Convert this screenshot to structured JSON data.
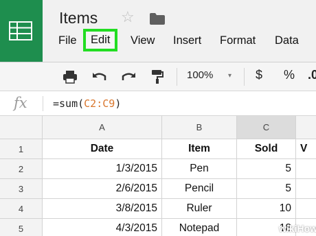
{
  "app": {
    "logo_icon": "sheets-grid-icon",
    "title": "Items",
    "star_icon": "star-icon",
    "folder_icon": "folder-icon"
  },
  "menu": {
    "items": [
      "File",
      "Edit",
      "View",
      "Insert",
      "Format",
      "Data"
    ],
    "highlighted": "Edit"
  },
  "toolbar": {
    "print_icon": "print-icon",
    "undo_icon": "undo-icon",
    "redo_icon": "redo-icon",
    "paint_format_icon": "paint-format-icon",
    "zoom": "100%",
    "zoom_caret": "▾",
    "currency": "$",
    "percent": "%",
    "decrease_decimal": ".0"
  },
  "formula_bar": {
    "fx_label": "fx",
    "prefix": "=sum(",
    "ref": "C2:C9",
    "suffix": ")"
  },
  "sheet": {
    "columns": [
      "A",
      "B",
      "C",
      ""
    ],
    "selected_column": "C",
    "rows": [
      {
        "num": "1",
        "cells": [
          "Date",
          "Item",
          "Sold",
          "V"
        ]
      },
      {
        "num": "2",
        "cells": [
          "1/3/2015",
          "Pen",
          "5",
          ""
        ]
      },
      {
        "num": "3",
        "cells": [
          "2/6/2015",
          "Pencil",
          "5",
          ""
        ]
      },
      {
        "num": "4",
        "cells": [
          "3/8/2015",
          "Ruler",
          "10",
          ""
        ]
      },
      {
        "num": "5",
        "cells": [
          "4/3/2015",
          "Notepad",
          "18",
          ""
        ]
      }
    ]
  },
  "watermark": {
    "text": "wikiHow"
  },
  "colors": {
    "brand_green": "#1e8e4e",
    "highlight_green": "#22dd22",
    "range_ref": "#d9762c"
  }
}
